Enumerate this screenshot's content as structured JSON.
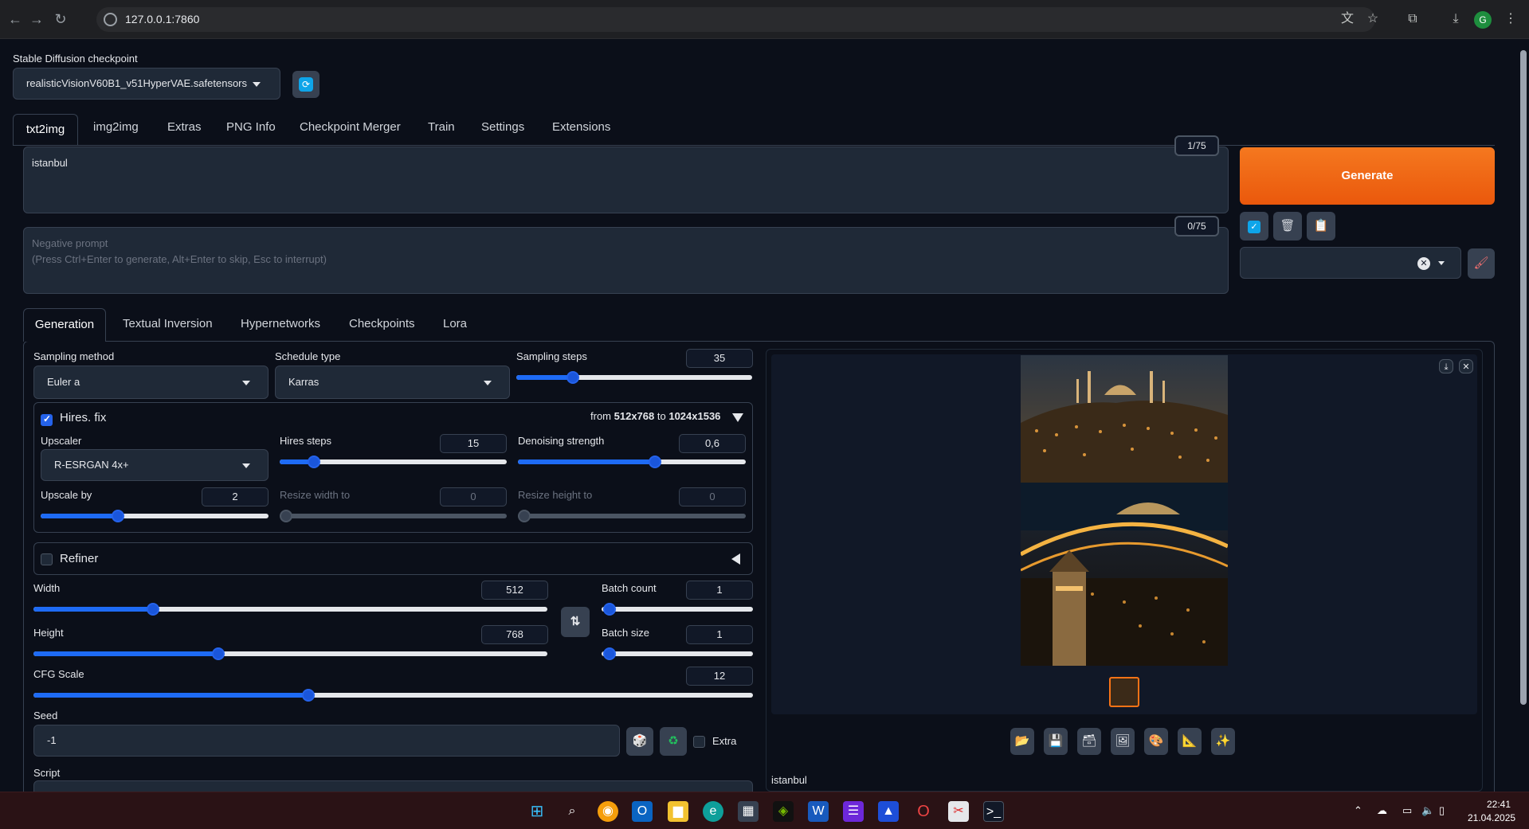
{
  "browser": {
    "url": "127.0.0.1:7860",
    "profile_initial": "G"
  },
  "checkpoint": {
    "label": "Stable Diffusion checkpoint",
    "value": "realisticVisionV60B1_v51HyperVAE.safetensors"
  },
  "main_tabs": [
    "txt2img",
    "img2img",
    "Extras",
    "PNG Info",
    "Checkpoint Merger",
    "Train",
    "Settings",
    "Extensions"
  ],
  "prompt": {
    "value": "istanbul",
    "counter": "1/75"
  },
  "negative_prompt": {
    "placeholder_line1": "Negative prompt",
    "placeholder_line2": "(Press Ctrl+Enter to generate, Alt+Enter to skip, Esc to interrupt)",
    "counter": "0/75"
  },
  "generate_label": "Generate",
  "sub_tabs": [
    "Generation",
    "Textual Inversion",
    "Hypernetworks",
    "Checkpoints",
    "Lora"
  ],
  "sampling": {
    "method_label": "Sampling method",
    "method_value": "Euler a",
    "schedule_label": "Schedule type",
    "schedule_value": "Karras",
    "steps_label": "Sampling steps",
    "steps_value": "35",
    "steps_fraction": 0.24
  },
  "hires": {
    "label": "Hires. fix",
    "summary_from": "from",
    "summary_from_size": "512x768",
    "summary_to": "to",
    "summary_to_size": "1024x1536",
    "upscaler_label": "Upscaler",
    "upscaler_value": "R-ESRGAN 4x+",
    "steps_label": "Hires steps",
    "steps_value": "15",
    "steps_fraction": 0.15,
    "denoise_label": "Denoising strength",
    "denoise_value": "0,6",
    "denoise_fraction": 0.6,
    "upscale_by_label": "Upscale by",
    "upscale_by_value": "2",
    "upscale_by_fraction": 0.34,
    "resize_w_label": "Resize width to",
    "resize_w_value": "0",
    "resize_h_label": "Resize height to",
    "resize_h_value": "0"
  },
  "refiner_label": "Refiner",
  "dims": {
    "width_label": "Width",
    "width_value": "512",
    "width_fraction": 0.233,
    "height_label": "Height",
    "height_value": "768",
    "height_fraction": 0.359,
    "batch_count_label": "Batch count",
    "batch_count_value": "1",
    "batch_size_label": "Batch size",
    "batch_size_value": "1"
  },
  "cfg": {
    "label": "CFG Scale",
    "value": "12",
    "fraction": 0.382
  },
  "seed": {
    "label": "Seed",
    "value": "-1",
    "extra_label": "Extra"
  },
  "script_label": "Script",
  "output": {
    "caption": "istanbul"
  },
  "taskbar": {
    "time": "22:41",
    "date": "21.04.2025"
  },
  "colors": {
    "generate_button": "#f0661e",
    "slider_fill": "#1e6bf5",
    "background": "#0b0f19"
  }
}
